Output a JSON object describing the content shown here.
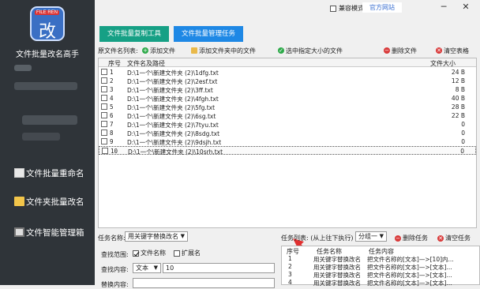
{
  "app": {
    "logo_tag": "FILE REN",
    "logo_char": "改",
    "title": "文件批量改名高手"
  },
  "sidebar": {
    "items": [
      {
        "label": "文件批量重命名",
        "icon": "document-icon"
      },
      {
        "label": "文件夹批量改名",
        "icon": "folder-icon"
      },
      {
        "label": "文件智能管理箱",
        "icon": "film-icon"
      }
    ]
  },
  "topbar": {
    "compat_label": "兼容模式",
    "website_label": "官方网站",
    "minimize": "─",
    "close": "✕"
  },
  "tabs": {
    "copy_tool": "文件批量复制工具",
    "manage_task": "文件批量管理任务"
  },
  "toolbar": {
    "list_label": "原文件名列表:",
    "add_file": "添加文件",
    "add_folder_files": "添加文件夹中的文件",
    "select_size": "选中指定大小的文件",
    "delete_file": "删除文件",
    "clear_table": "清空表格"
  },
  "file_table": {
    "headers": {
      "num": "序号",
      "path": "文件名及路径",
      "size": "文件大小"
    },
    "rows": [
      {
        "num": "1",
        "path": "D:\\1一个\\新建文件夹 (2)\\1dfg.txt",
        "size": "24 B"
      },
      {
        "num": "2",
        "path": "D:\\1一个\\新建文件夹 (2)\\2esf.txt",
        "size": "12 B"
      },
      {
        "num": "3",
        "path": "D:\\1一个\\新建文件夹 (2)\\3ff.txt",
        "size": "8 B"
      },
      {
        "num": "4",
        "path": "D:\\1一个\\新建文件夹 (2)\\4fgh.txt",
        "size": "40 B"
      },
      {
        "num": "5",
        "path": "D:\\1一个\\新建文件夹 (2)\\5fg.txt",
        "size": "28 B"
      },
      {
        "num": "6",
        "path": "D:\\1一个\\新建文件夹 (2)\\6sg.txt",
        "size": "22 B"
      },
      {
        "num": "7",
        "path": "D:\\1一个\\新建文件夹 (2)\\7tyu.txt",
        "size": "0"
      },
      {
        "num": "8",
        "path": "D:\\1一个\\新建文件夹 (2)\\8sdg.txt",
        "size": "0"
      },
      {
        "num": "9",
        "path": "D:\\1一个\\新建文件夹 (2)\\9dsjh.txt",
        "size": "0"
      },
      {
        "num": "10",
        "path": "D:\\1一个\\新建文件夹 (2)\\10srh.txt",
        "size": "0"
      }
    ]
  },
  "task": {
    "name_label": "任务名称:",
    "name_value": "用关键字替换改名",
    "scope_label": "查找范围:",
    "scope_filename": "文件名称",
    "scope_ext": "扩展名",
    "content_label": "查找内容:",
    "content_type": "文本",
    "content_value": "10",
    "replace_label": "替换内容:"
  },
  "task_list": {
    "label": "任务列表: (从上往下执行)",
    "group_value": "分组一",
    "delete_task": "删除任务",
    "clear_tasks": "清空任务",
    "headers": {
      "num": "序号",
      "name": "任务名称",
      "content": "任务内容"
    },
    "rows": [
      {
        "num": "1",
        "name": "用关键字替换改名",
        "content": "把文件名称的[文本]—>[10]内..."
      },
      {
        "num": "2",
        "name": "用关键字替换改名",
        "content": "把文件名称的[文本]—>[文本]..."
      },
      {
        "num": "3",
        "name": "用关键字替换改名",
        "content": "把文件名称的[文本]—>[文本]..."
      },
      {
        "num": "4",
        "name": "用关键字替换改名",
        "content": "把文件名称的[文本]—>[文本]..."
      }
    ]
  }
}
